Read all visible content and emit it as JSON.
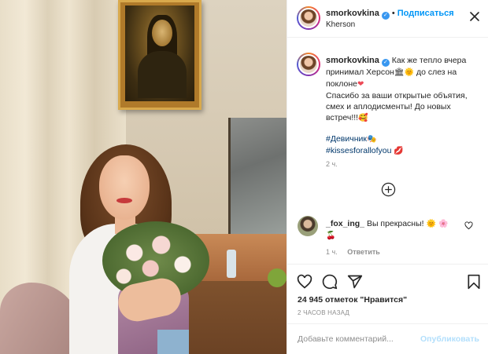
{
  "post": {
    "author": {
      "username": "smorkovkina",
      "verified_icon": "verified-badge-icon",
      "follow_label": "Подписаться",
      "location": "Kherson"
    },
    "caption": {
      "username": "smorkovkina",
      "lines": [
        "Как же тепло вчера",
        "принимал Херсон",
        "поклоне",
        "Спасибо за ваши открытые объятия,",
        "смех и аплодисменты! До новых",
        "встреч!!!"
      ],
      "middle_fragment": "до слез на",
      "emojis": {
        "after_kherson": "🏛",
        "sun": "🌞",
        "heart": "❤",
        "smile": "🥰",
        "masks": "🎭",
        "lips": "💋"
      },
      "hashtags": [
        "#Девичник",
        "#kissesforallofyou"
      ],
      "time": "2 ч."
    },
    "comments": [
      {
        "username": "_fox_ing_",
        "text": "Вы прекрасны!",
        "emojis": "🌞 🌸",
        "emoji_line2": "🍒",
        "time": "1 ч.",
        "reply_label": "Ответить"
      }
    ],
    "likes_text": "24 945 отметок \"Нравится\"",
    "posted_ago": "2 ЧАСОВ НАЗАД",
    "comment_box": {
      "placeholder": "Добавьте комментарий...",
      "publish_label": "Опубликовать"
    },
    "colors": {
      "accent_blue": "#0095f6",
      "hashtag": "#00376b",
      "muted": "#8e8e8e",
      "publish_disabled": "#b2dffc"
    },
    "icons": [
      "more-options-icon",
      "add-circle-icon",
      "heart-icon",
      "comment-icon",
      "share-icon",
      "bookmark-icon"
    ]
  }
}
